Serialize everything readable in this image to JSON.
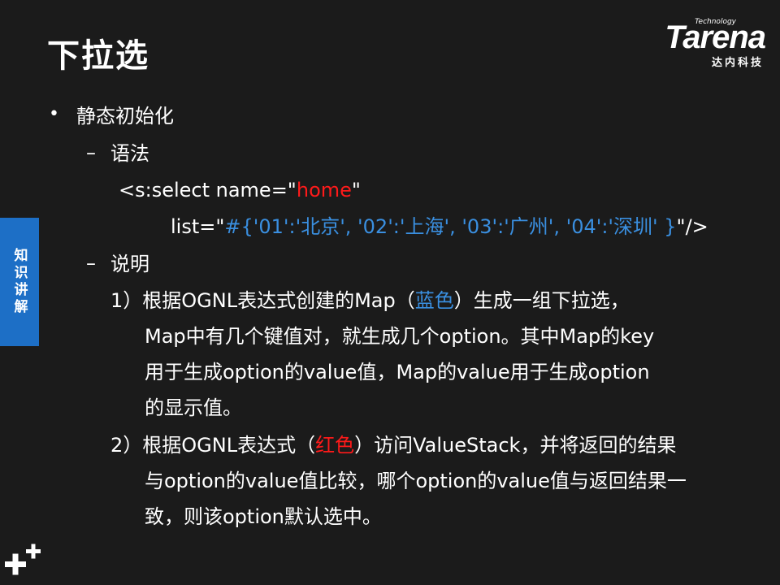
{
  "title": "下拉选",
  "logo": {
    "tech": "Technology",
    "word": "Tarena",
    "sub": "达内科技"
  },
  "side_tab": "知识讲解",
  "bullet": "•",
  "dash": "–",
  "items": {
    "level1": "静态初始化",
    "syntax_heading": "语法",
    "code_line1_a": "<s:select name=\"",
    "code_line1_b": "home",
    "code_line1_c": "\"",
    "code_line2_a": "list=\"",
    "code_line2_b": "#{'01':'北京', '02':'上海', '03':'广州', '04':'深圳' }",
    "code_line2_c": "\"/>",
    "explain_heading": "说明",
    "p1_a": "1）根据OGNL表达式创建的Map（",
    "p1_b": "蓝色",
    "p1_c": "）生成一组下拉选，",
    "p1_l2": "Map中有几个键值对，就生成几个option。其中Map的key",
    "p1_l3": "用于生成option的value值，Map的value用于生成option",
    "p1_l4": "的显示值。",
    "p2_a": "2）根据OGNL表达式（",
    "p2_b": "红色",
    "p2_c": "）访问ValueStack，并将返回的结果",
    "p2_l2": "与option的value值比较，哪个option的value值与返回结果一",
    "p2_l3": "致，则该option默认选中。"
  },
  "colors": {
    "background": "#1b1b1b",
    "blue": "#3a8fe0",
    "red": "#ff1a1a",
    "tab": "#1d6fc6"
  }
}
